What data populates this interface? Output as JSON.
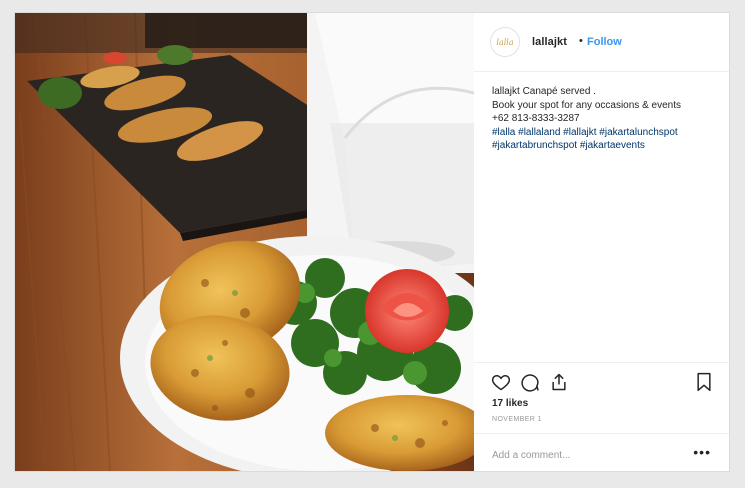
{
  "post": {
    "avatar_text": "lalla",
    "username": "lallajkt",
    "separator": "•",
    "follow_label": "Follow",
    "caption_lines": [
      "lallajkt Canapé served .",
      "Book your spot for any occasions & events",
      "+62 813-8333-3287"
    ],
    "hashtag_lines": [
      "#lalla #lallaland #lallajkt #jakartalunchspot",
      "#jakartabrunchspot #jakartaevents"
    ],
    "likes": "17 likes",
    "date": "NOVEMBER 1",
    "comment_placeholder": "Add a comment...",
    "more_label": "•••"
  },
  "icons": [
    "heart-icon",
    "comment-icon",
    "share-icon",
    "bookmark-icon"
  ],
  "colors": {
    "accent": "#3897f0",
    "hashtag": "#003569",
    "text": "#262626",
    "muted": "#999999"
  }
}
